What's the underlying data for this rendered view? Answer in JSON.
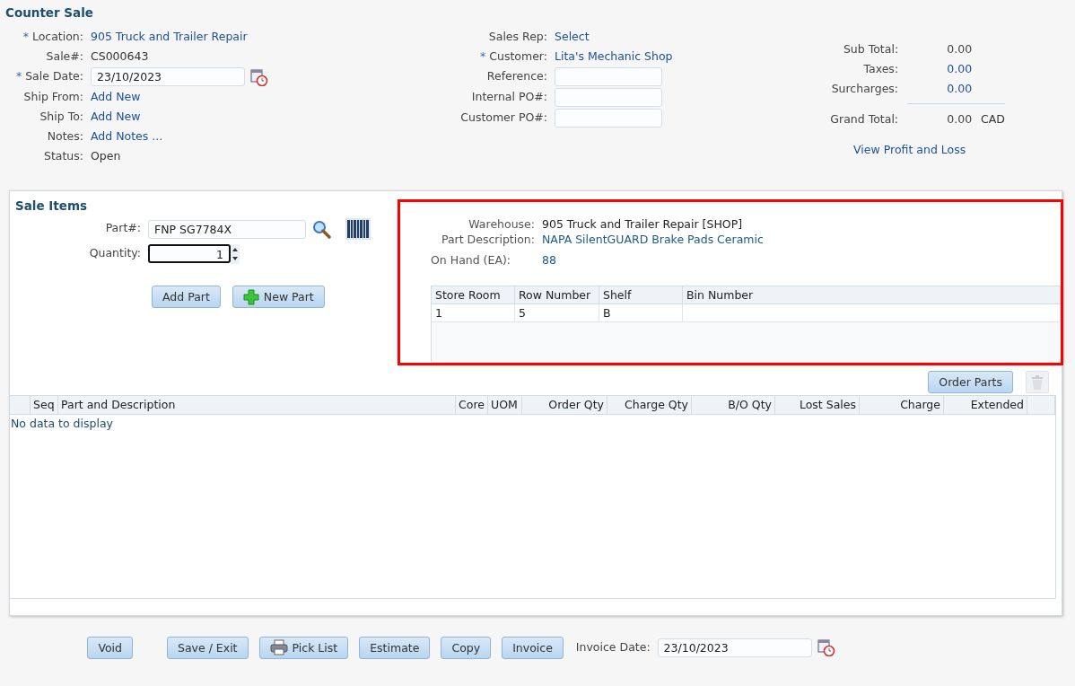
{
  "title": "Counter Sale",
  "left_fields": [
    {
      "marker": "*",
      "label": "Location:",
      "value": "905 Truck and Trailer Repair",
      "kind": "link"
    },
    {
      "label": "Sale#:",
      "value": "CS000643",
      "kind": "text"
    },
    {
      "marker": "*",
      "label": "Sale Date:",
      "value": "23/10/2023",
      "kind": "date"
    },
    {
      "label": "Ship From:",
      "value": "Add New",
      "kind": "link"
    },
    {
      "label": "Ship To:",
      "value": "Add New",
      "kind": "link"
    },
    {
      "label": "Notes:",
      "value": "Add Notes ...",
      "kind": "link"
    },
    {
      "label": "Status:",
      "value": "Open",
      "kind": "text"
    }
  ],
  "middle_fields": [
    {
      "label": "Sales Rep:",
      "value": "Select",
      "kind": "link"
    },
    {
      "marker": "*",
      "label": "Customer:",
      "value": "Lita's Mechanic Shop",
      "kind": "link"
    },
    {
      "label": "Reference:",
      "kind": "input"
    },
    {
      "label": "Internal PO#:",
      "kind": "input"
    },
    {
      "label": "Customer PO#:",
      "kind": "input"
    }
  ],
  "totals": [
    {
      "label": "Sub Total:",
      "value": "0.00",
      "kind": "text"
    },
    {
      "label": "Taxes:",
      "value": "0.00",
      "kind": "link"
    },
    {
      "label": "Surcharges:",
      "value": "0.00",
      "kind": "link"
    }
  ],
  "grand_total": {
    "label": "Grand Total:",
    "value": "0.00",
    "currency": "CAD"
  },
  "profit_link": "View Profit and Loss",
  "sale_items": {
    "title": "Sale Items",
    "part": {
      "label": "Part#:",
      "value": "FNP SG7784X"
    },
    "quantity": {
      "label": "Quantity:",
      "value": "1",
      "focused": true
    },
    "buttons": [
      {
        "label": "Add Part",
        "kind": "plain"
      },
      {
        "label": "New Part",
        "kind": "add"
      }
    ]
  },
  "part_info": {
    "highlighted": true,
    "fields": [
      {
        "label": "Warehouse:",
        "value": "905 Truck and Trailer Repair [SHOP]",
        "kind": "text"
      },
      {
        "label": "Part Description:",
        "value": "NAPA SilentGUARD Brake Pads Ceramic",
        "kind": "link"
      },
      {
        "label": "On Hand (EA):",
        "value": "88",
        "kind": "link"
      }
    ],
    "location_table": {
      "columns": [
        "Store Room",
        "Row Number",
        "Shelf",
        "Bin Number"
      ],
      "rows": [
        [
          "1",
          "5",
          "B",
          ""
        ]
      ]
    }
  },
  "order_parts_button": "Order Parts",
  "delete_disabled": true,
  "lines_table": {
    "columns": [
      "Seq",
      "Part and Description",
      "Core",
      "UOM",
      "Order Qty",
      "Charge Qty",
      "B/O Qty",
      "Lost Sales",
      "Charge",
      "Extended"
    ],
    "empty_text": "No data to display"
  },
  "footer": {
    "buttons": [
      {
        "label": "Void",
        "kind": "plain"
      },
      {
        "label": "Save / Exit",
        "kind": "plain"
      },
      {
        "label": "Pick List",
        "kind": "print"
      },
      {
        "label": "Estimate",
        "kind": "plain"
      },
      {
        "label": "Copy",
        "kind": "plain"
      },
      {
        "label": "Invoice",
        "kind": "plain"
      }
    ],
    "invoice_date": {
      "label": "Invoice Date:",
      "value": "23/10/2023"
    }
  }
}
